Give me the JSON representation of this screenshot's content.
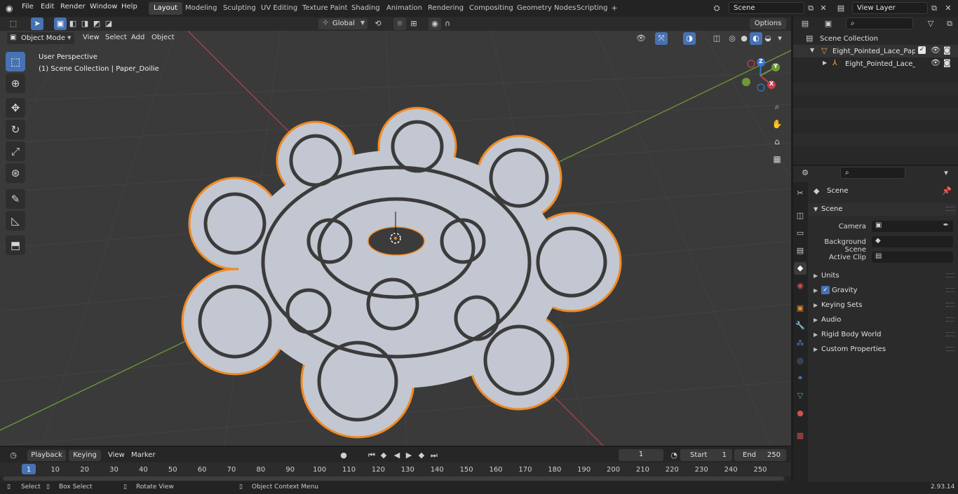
{
  "menu": {
    "file": "File",
    "edit": "Edit",
    "render": "Render",
    "window": "Window",
    "help": "Help"
  },
  "workspaces": [
    "Layout",
    "Modeling",
    "Sculpting",
    "UV Editing",
    "Texture Paint",
    "Shading",
    "Animation",
    "Rendering",
    "Compositing",
    "Geometry Nodes",
    "Scripting"
  ],
  "scene_field": "Scene",
  "view_layer_field": "View Layer",
  "viewport": {
    "mode": "Object Mode",
    "menu_view": "View",
    "menu_select": "Select",
    "menu_add": "Add",
    "menu_object": "Object",
    "orientation": "Global",
    "options": "Options",
    "overlay_line1": "User Perspective",
    "overlay_line2": "(1) Scene Collection | Paper_Doilie"
  },
  "gizmo": {
    "x": "X",
    "y": "Y",
    "z": "Z"
  },
  "outliner": {
    "root": "Scene Collection",
    "item1": "Eight_Pointed_Lace_Paper_Do",
    "item2": "Eight_Pointed_Lace_Pape"
  },
  "properties": {
    "header": "Scene",
    "section": "Scene",
    "camera_label": "Camera",
    "bg_scene_label": "Background Scene",
    "active_clip_label": "Active Clip",
    "panels": [
      "Units",
      "Gravity",
      "Keying Sets",
      "Audio",
      "Rigid Body World",
      "Custom Properties"
    ],
    "gravity_checked": true
  },
  "timeline": {
    "playback": "Playback",
    "keying": "Keying",
    "view": "View",
    "marker": "Marker",
    "current_frame": "1",
    "start_label": "Start",
    "start": "1",
    "end_label": "End",
    "end": "250",
    "ticks": [
      "1",
      "10",
      "20",
      "30",
      "40",
      "50",
      "60",
      "70",
      "80",
      "90",
      "100",
      "110",
      "120",
      "130",
      "140",
      "150",
      "160",
      "170",
      "180",
      "190",
      "200",
      "210",
      "220",
      "230",
      "240",
      "250"
    ]
  },
  "status": {
    "select": "Select",
    "box_select": "Box Select",
    "rotate_view": "Rotate View",
    "context_menu": "Object Context Menu",
    "version": "2.93.14"
  },
  "colors": {
    "accent": "#4772b3",
    "selection_outline": "#f08a24",
    "object_fill": "#c3c7d1",
    "axis_x": "#b5404a",
    "axis_y": "#6e9a35"
  }
}
